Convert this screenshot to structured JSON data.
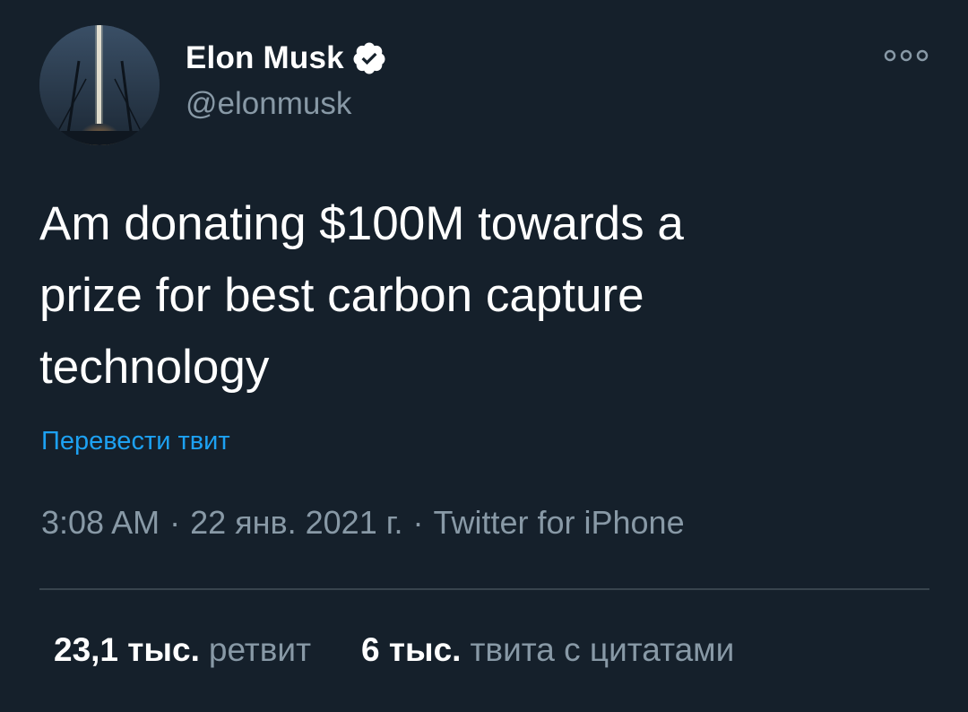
{
  "user": {
    "display_name": "Elon Musk",
    "handle": "@elonmusk",
    "verified": true
  },
  "icons": {
    "avatar": "avatar-rocket-launch",
    "verified": "verified-badge-icon",
    "more": "more-options-icon"
  },
  "tweet": {
    "text": "Am donating $100M towards a\nprize for best carbon capture\ntechnology",
    "translate_label": "Перевести твит"
  },
  "meta": {
    "time": "3:08 AM",
    "separator": "·",
    "date": "22 янв. 2021 г.",
    "source": "Twitter for iPhone"
  },
  "stats": {
    "retweets_count": "23,1 тыс.",
    "retweets_label": "ретвит",
    "quotes_count": "6 тыс.",
    "quotes_label": "твита с цитатами"
  },
  "colors": {
    "background": "#15202b",
    "text": "#ffffff",
    "secondary": "#8899a6",
    "link": "#1da1f2",
    "divider": "#38444d"
  }
}
